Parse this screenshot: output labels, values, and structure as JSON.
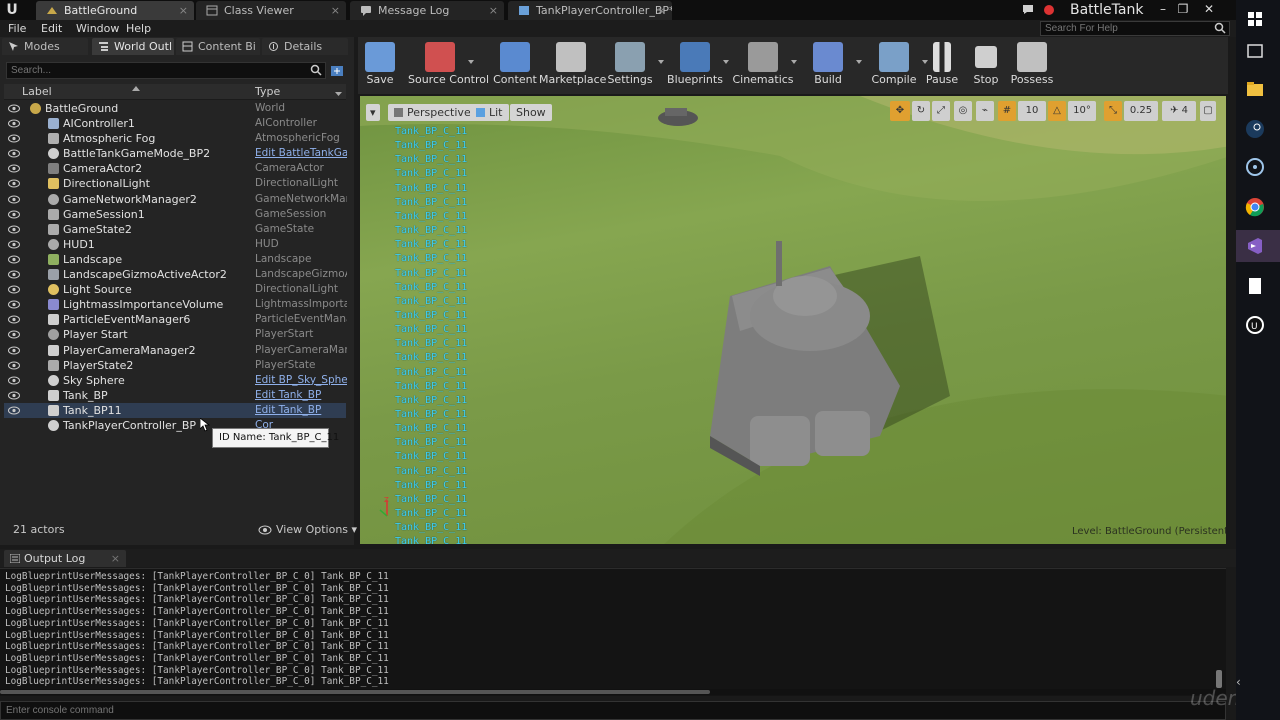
{
  "app_title": "BattleTank",
  "doc_tabs": [
    "BattleGround",
    "Class Viewer",
    "Message Log",
    "TankPlayerController_BP*"
  ],
  "menu": [
    "File",
    "Edit",
    "Window",
    "Help"
  ],
  "help_search_placeholder": "Search For Help",
  "panel_tabs": [
    "Modes",
    "World Outl",
    "Content Bi",
    "Details"
  ],
  "outliner": {
    "search_placeholder": "Search...",
    "col_label": "Label",
    "col_type": "Type",
    "rows": [
      {
        "label": "BattleGround",
        "type": "World",
        "link": false
      },
      {
        "label": "AIController1",
        "type": "AIController",
        "link": false
      },
      {
        "label": "Atmospheric Fog",
        "type": "AtmosphericFog",
        "link": false
      },
      {
        "label": "BattleTankGameMode_BP2",
        "type": "Edit BattleTankGam",
        "link": true
      },
      {
        "label": "CameraActor2",
        "type": "CameraActor",
        "link": false
      },
      {
        "label": "DirectionalLight",
        "type": "DirectionalLight",
        "link": false
      },
      {
        "label": "GameNetworkManager2",
        "type": "GameNetworkManag",
        "link": false
      },
      {
        "label": "GameSession1",
        "type": "GameSession",
        "link": false
      },
      {
        "label": "GameState2",
        "type": "GameState",
        "link": false
      },
      {
        "label": "HUD1",
        "type": "HUD",
        "link": false
      },
      {
        "label": "Landscape",
        "type": "Landscape",
        "link": false
      },
      {
        "label": "LandscapeGizmoActiveActor2",
        "type": "LandscapeGizmoAct",
        "link": false
      },
      {
        "label": "Light Source",
        "type": "DirectionalLight",
        "link": false
      },
      {
        "label": "LightmassImportanceVolume",
        "type": "LightmassImportanc",
        "link": false
      },
      {
        "label": "ParticleEventManager6",
        "type": "ParticleEventManage",
        "link": false
      },
      {
        "label": "Player Start",
        "type": "PlayerStart",
        "link": false
      },
      {
        "label": "PlayerCameraManager2",
        "type": "PlayerCameraManag",
        "link": false
      },
      {
        "label": "PlayerState2",
        "type": "PlayerState",
        "link": false
      },
      {
        "label": "Sky Sphere",
        "type": "Edit BP_Sky_Sphere",
        "link": true
      },
      {
        "label": "Tank_BP",
        "type": "Edit Tank_BP",
        "link": true
      },
      {
        "label": "Tank_BP11",
        "type": "Edit Tank_BP",
        "link": true
      },
      {
        "label": "TankPlayerController_BP",
        "type": "Cor",
        "link": true
      }
    ],
    "tooltip": "ID Name: Tank_BP_C_11",
    "actor_count": "21 actors",
    "view_options": "View Options"
  },
  "toolbar": [
    "Save",
    "Source Control",
    "Content",
    "Marketplace",
    "Settings",
    "Blueprints",
    "Cinematics",
    "Build",
    "Compile",
    "Pause",
    "Stop",
    "Possess"
  ],
  "viewport": {
    "perspective": "Perspective",
    "lit": "Lit",
    "show": "Show",
    "snap_grid": "10",
    "snap_rot": "10°",
    "snap_scale": "0.25",
    "cam_speed": "4",
    "tank_label": "Tank_BP_C_11",
    "tank_label_count": 30,
    "level": "Level:  BattleGround (Persistent)"
  },
  "output_log": {
    "tab": "Output Log",
    "line": "LogBlueprintUserMessages: [TankPlayerController_BP_C_0] Tank_BP_C_11",
    "line_count": 10,
    "console_placeholder": "Enter console command"
  },
  "watermark": "udemy",
  "colors": {
    "accent_blue": "#3fd0f0",
    "link": "#8fb0ea",
    "selection": "#2f3d52"
  }
}
